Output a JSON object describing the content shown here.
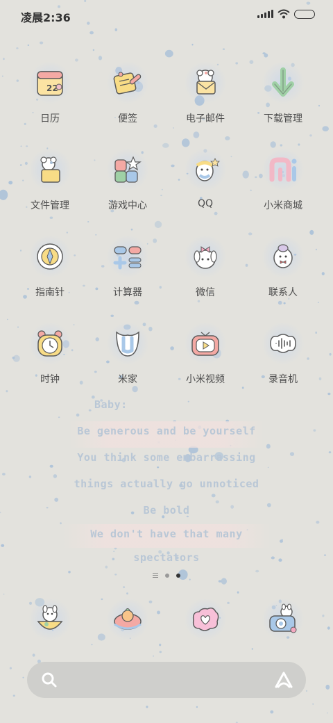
{
  "status_bar": {
    "time": "凌晨2:36",
    "icons": [
      "signal-icon",
      "wifi-icon",
      "battery-icon"
    ]
  },
  "apps": [
    {
      "label": "日历",
      "icon": "calendar-icon",
      "badge": "22"
    },
    {
      "label": "便签",
      "icon": "notes-icon"
    },
    {
      "label": "电子邮件",
      "icon": "email-icon"
    },
    {
      "label": "下载管理",
      "icon": "download-icon"
    },
    {
      "label": "文件管理",
      "icon": "file-manager-icon"
    },
    {
      "label": "游戏中心",
      "icon": "game-center-icon"
    },
    {
      "label": "QQ",
      "icon": "qq-icon"
    },
    {
      "label": "小米商城",
      "icon": "mi-store-icon"
    },
    {
      "label": "指南针",
      "icon": "compass-icon"
    },
    {
      "label": "计算器",
      "icon": "calculator-icon"
    },
    {
      "label": "微信",
      "icon": "wechat-icon"
    },
    {
      "label": "联系人",
      "icon": "contacts-icon"
    },
    {
      "label": "时钟",
      "icon": "clock-icon"
    },
    {
      "label": "米家",
      "icon": "mijia-icon"
    },
    {
      "label": "小米视频",
      "icon": "video-icon"
    },
    {
      "label": "录音机",
      "icon": "recorder-icon"
    }
  ],
  "quote": [
    "Baby:",
    "Be generous and be yourself",
    "You think some embarrassing",
    "things actually go unnoticed",
    "Be bold",
    "We don't have that many",
    "spectators"
  ],
  "dock": [
    {
      "icon": "phone-icon"
    },
    {
      "icon": "messages-icon"
    },
    {
      "icon": "browser-icon"
    },
    {
      "icon": "camera-icon"
    }
  ],
  "search_bar": {
    "icons": [
      "search-icon",
      "voice-assistant-icon"
    ]
  },
  "colors": {
    "background": "#e3e2dd",
    "speckle": "#a9c0d8",
    "label": "#4d4d4d"
  }
}
